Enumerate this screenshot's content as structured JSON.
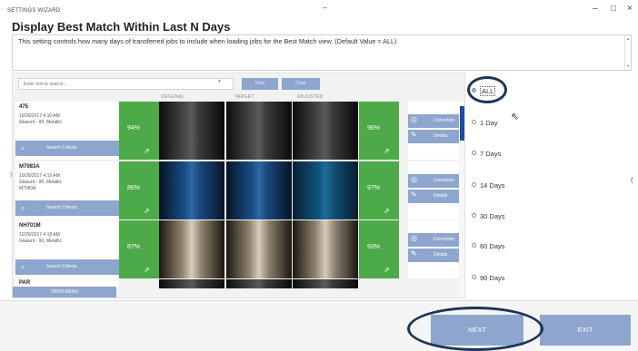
{
  "window": {
    "app_title": "SETTINGS WIZARD",
    "title_dash": "–",
    "minimize": "–",
    "maximize": "□",
    "close": "×"
  },
  "heading": "Display Best Match Within Last N Days",
  "description": "This setting controls how many days of transferred jobs to include when loading jobs for the Best Match view.  (Default Value = ALL)",
  "search": {
    "placeholder": "Enter text to search...",
    "find_label": "Find",
    "clear_label": "Clear"
  },
  "columns": [
    "ORIGINAL",
    "TARGET",
    "ADJUSTED"
  ],
  "jobs": [
    {
      "id": "475",
      "lines": [
        "10/26/2017 4:10 AM",
        "Glasurit - 90, Metallic"
      ],
      "original_pct": "94%",
      "adjusted_pct": "96%",
      "swatch": "black",
      "search_label": "Search Criteria",
      "correction_label": "Correction",
      "details_label": "Details"
    },
    {
      "id": "M7083A",
      "lines": [
        "10/26/2017 4:19 AM",
        "Glasurit - 90, Metallic",
        "M7083A"
      ],
      "original_pct": "86%",
      "adjusted_pct": "97%",
      "swatch": "blue",
      "search_label": "Search Criteria",
      "correction_label": "Correction",
      "details_label": "Details"
    },
    {
      "id": "NH701M",
      "lines": [
        "10/26/2017 4:18 AM",
        "Glasurit - 90, Metallic"
      ],
      "original_pct": "87%",
      "adjusted_pct": "93%",
      "swatch": "beige",
      "search_label": "Search Criteria",
      "correction_label": "Correction",
      "details_label": "Details"
    }
  ],
  "partial_job_id": "PAR",
  "open_menu_label": "OPEN MENU",
  "options": [
    {
      "label": "ALL",
      "selected": true
    },
    {
      "label": "1 Day",
      "selected": false
    },
    {
      "label": "7 Days",
      "selected": false
    },
    {
      "label": "14 Days",
      "selected": false
    },
    {
      "label": "30 Days",
      "selected": false
    },
    {
      "label": "60 Days",
      "selected": false
    },
    {
      "label": "90 Days",
      "selected": false
    }
  ],
  "footer": {
    "next_label": "NEXT",
    "exit_label": "EXIT"
  },
  "colors": {
    "accent": "#8ea6cd",
    "match_green": "#4caa48",
    "annotation": "#1c3556",
    "scroll_thumb": "#1e4f9c"
  },
  "icons": {
    "search_criteria": "search-criteria-icon",
    "correction": "correction-icon",
    "details": "pencil-icon",
    "cursor": "mouse-cursor-icon"
  }
}
